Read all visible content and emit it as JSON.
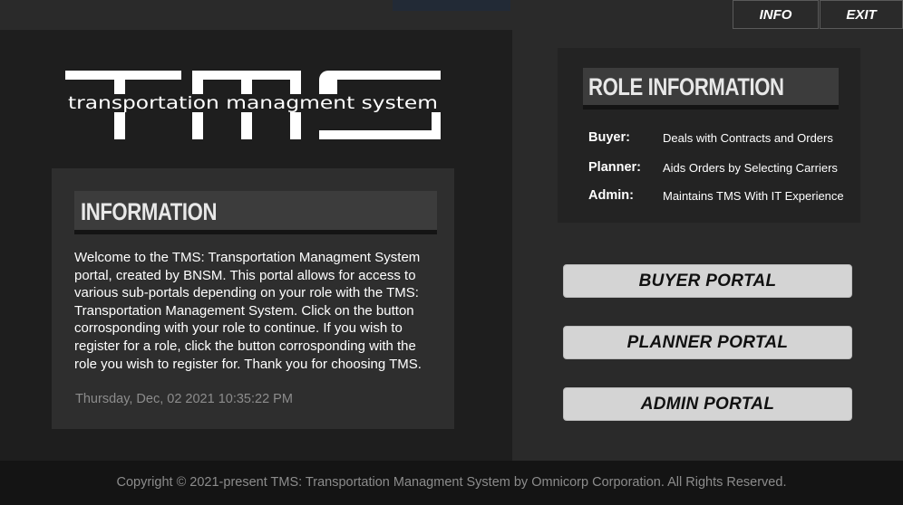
{
  "topbar": {
    "info_label": "INFO",
    "exit_label": "EXIT"
  },
  "logo": {
    "letters": "TMS",
    "tagline": "transportation managment system"
  },
  "information": {
    "title": "INFORMATION",
    "body": "Welcome to the TMS: Transportation Managment System portal, created by BNSM. This portal allows for access to various sub-portals depending on your role with the TMS: Transportation Management System. Click on the button corrosponding with your role to continue. If you wish to register for a role, click the button corrosponding with the role you wish to register for. Thank you for choosing TMS.",
    "datetime": "Thursday, Dec, 02 2021 10:35:22 PM"
  },
  "role_information": {
    "title": "ROLE INFORMATION",
    "roles": [
      {
        "name": "Buyer:",
        "description": "Deals with Contracts and Orders"
      },
      {
        "name": "Planner:",
        "description": "Aids Orders by Selecting Carriers"
      },
      {
        "name": "Admin:",
        "description": "Maintains TMS With IT Experience"
      }
    ]
  },
  "portals": {
    "buyer": "BUYER PORTAL",
    "planner": "PLANNER PORTAL",
    "admin": "ADMIN PORTAL"
  },
  "footer": {
    "copyright": "Copyright © 2021-present TMS: Transportation Managment System by Omnicorp Corporation. All Rights Reserved."
  },
  "colors": {
    "background": "#1a1a1a",
    "panel_dark": "#1e1e1e",
    "panel_right": "#2a2a2a",
    "card": "#2e2e2e",
    "header_bar": "#3c3c3c",
    "button": "#d4d4d4",
    "muted_text": "#8c8c8c"
  }
}
